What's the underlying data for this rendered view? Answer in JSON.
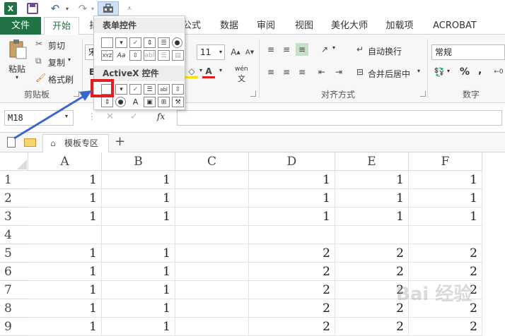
{
  "quick_access": {
    "app_icon": "X",
    "icons": [
      "excel-logo",
      "save-icon",
      "undo-icon",
      "redo-icon",
      "controls-icon",
      "customize-icon"
    ]
  },
  "tabs": [
    "文件",
    "开始",
    "插",
    "公式",
    "数据",
    "审阅",
    "视图",
    "美化大师",
    "加载项",
    "ACROBAT"
  ],
  "ribbon": {
    "clipboard": {
      "paste": "粘贴",
      "cut": "剪切",
      "copy": "复制",
      "format_painter": "格式刷",
      "group_label": "剪贴板"
    },
    "font": {
      "font_name_partial": "宋",
      "font_size": "11",
      "bold": "B",
      "phonetic": "wén"
    },
    "alignment": {
      "wrap_text": "自动换行",
      "merge_center": "合并后居中",
      "group_label": "对齐方式"
    },
    "number": {
      "format": "常规",
      "percent": "%",
      "comma": ",",
      "group_label": "数字"
    }
  },
  "formula_bar": {
    "name_box": "M18",
    "cancel": "✕",
    "enter": "✓",
    "fx": "fx"
  },
  "doc_tabs": {
    "active": "模板专区",
    "add": "+"
  },
  "dropdown": {
    "form_controls_title": "表单控件",
    "activex_title": "ActiveX 控件",
    "form_row2": [
      "XYZ",
      "Aa",
      "abl"
    ],
    "activex_row2": [
      "A",
      "⊞"
    ]
  },
  "grid": {
    "columns": [
      "A",
      "B",
      "C",
      "D",
      "E",
      "F"
    ],
    "rows": [
      {
        "label": "1",
        "cells": [
          "1",
          "1",
          "",
          "1",
          "1",
          "1"
        ]
      },
      {
        "label": "2",
        "cells": [
          "1",
          "1",
          "",
          "1",
          "1",
          "1"
        ]
      },
      {
        "label": "3",
        "cells": [
          "1",
          "1",
          "",
          "1",
          "1",
          "1"
        ]
      },
      {
        "label": "4",
        "cells": [
          "",
          "",
          "",
          "",
          "",
          ""
        ]
      },
      {
        "label": "5",
        "cells": [
          "1",
          "1",
          "",
          "2",
          "2",
          "2"
        ]
      },
      {
        "label": "6",
        "cells": [
          "1",
          "1",
          "",
          "2",
          "2",
          "2"
        ]
      },
      {
        "label": "7",
        "cells": [
          "1",
          "1",
          "",
          "2",
          "2",
          "2"
        ]
      },
      {
        "label": "8",
        "cells": [
          "1",
          "1",
          "",
          "2",
          "2",
          "2"
        ]
      },
      {
        "label": "9",
        "cells": [
          "1",
          "1",
          "",
          "2",
          "2",
          "2"
        ]
      }
    ]
  },
  "watermark": "Bai 经验",
  "colors": {
    "excel_green": "#217346",
    "highlight_red": "#e02020",
    "arrow_blue": "#3a66d0"
  }
}
